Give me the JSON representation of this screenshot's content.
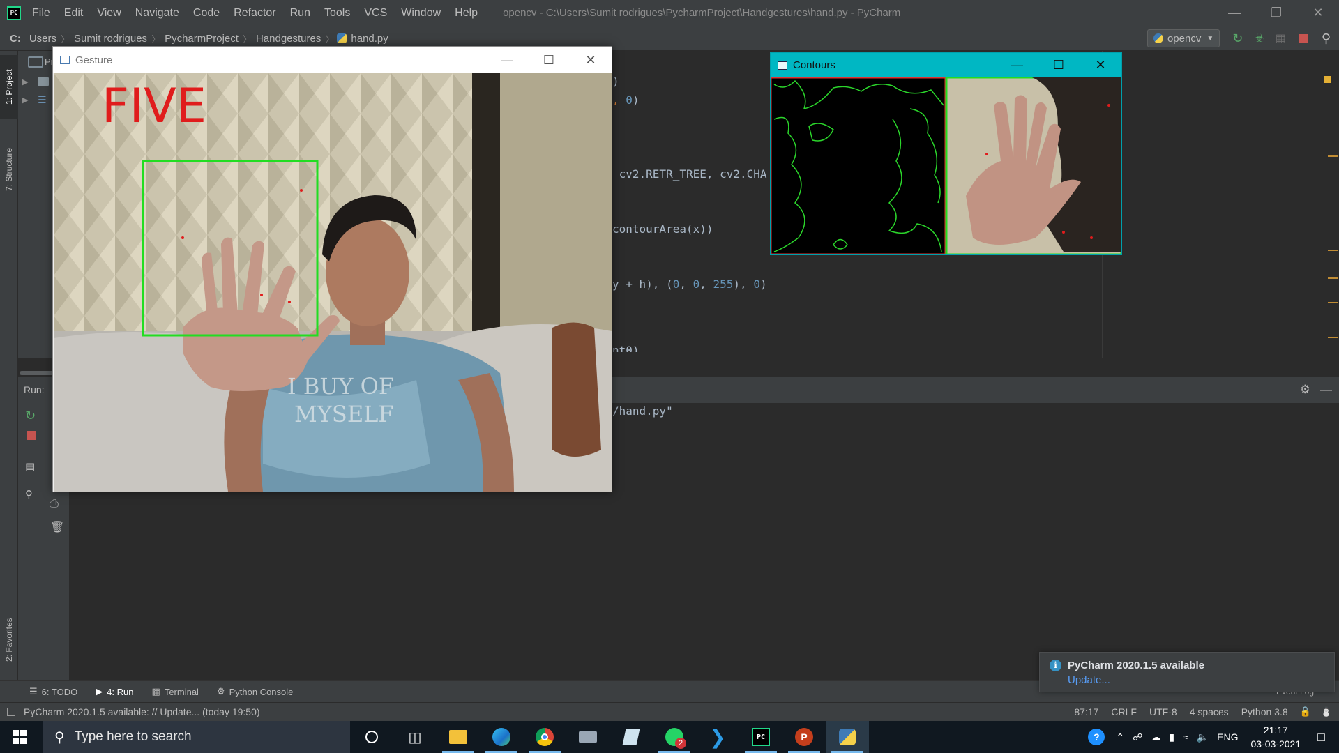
{
  "titlebar": {
    "menu": [
      "File",
      "Edit",
      "View",
      "Navigate",
      "Code",
      "Refactor",
      "Run",
      "Tools",
      "VCS",
      "Window",
      "Help"
    ],
    "window_title": "opencv - C:\\Users\\Sumit rodrigues\\PycharmProject\\Handgestures\\hand.py - PyCharm"
  },
  "navbar": {
    "drive": "C:",
    "crumbs": [
      "Users",
      "Sumit rodrigues",
      "PycharmProject",
      "Handgestures"
    ],
    "file": "hand.py",
    "interpreter": "opencv"
  },
  "left_strip": {
    "project": "1: Project",
    "structure": "7: Structure",
    "favorites": "2: Favorites"
  },
  "project_panel": {
    "label": "Pr"
  },
  "editor": {
    "lines": [
      {
        "text": ")"
      },
      {
        "text": ", 0)"
      },
      {
        "text": " cv2.RETR_TREE, cv2.CHA"
      },
      {
        "text": "contourArea(x))"
      },
      {
        "text": "y + h), (0, 0, 255), 0)"
      },
      {
        "text": "nt0)"
      }
    ]
  },
  "run": {
    "label": "Run:",
    "console_line": "/hand.py\""
  },
  "gesture_window": {
    "title": "Gesture",
    "overlay_text": "FIVE",
    "overlay_color": "#e01c1c",
    "box_color": "#22dd22",
    "shirt_text_1": "I BUY OF",
    "shirt_text_2": "MYSELF"
  },
  "contours_window": {
    "title": "Contours",
    "titlebar_color": "#00b7c3"
  },
  "tool_tabs": [
    {
      "label": "6: TODO",
      "icon": "list-icon"
    },
    {
      "label": "4: Run",
      "icon": "run-icon"
    },
    {
      "label": "Terminal",
      "icon": "terminal-icon"
    },
    {
      "label": "Python Console",
      "icon": "python-console-icon"
    }
  ],
  "event_log": "Event Log",
  "status": {
    "message": "PyCharm 2020.1.5 available: // Update... (today 19:50)",
    "position": "87:17",
    "line_sep": "CRLF",
    "encoding": "UTF-8",
    "indent": "4 spaces",
    "interpreter": "Python 3.8"
  },
  "notification": {
    "title": "PyCharm 2020.1.5 available",
    "link": "Update..."
  },
  "taskbar": {
    "search_placeholder": "Type here to search",
    "whatsapp_badge": "2",
    "lang": "ENG",
    "time": "21:17",
    "date": "03-03-2021"
  },
  "colors": {
    "ide_bg": "#2b2b2b",
    "panel_bg": "#3c3f41",
    "code_text": "#a9b7c6",
    "code_number": "#6897bb",
    "link": "#589df6"
  }
}
